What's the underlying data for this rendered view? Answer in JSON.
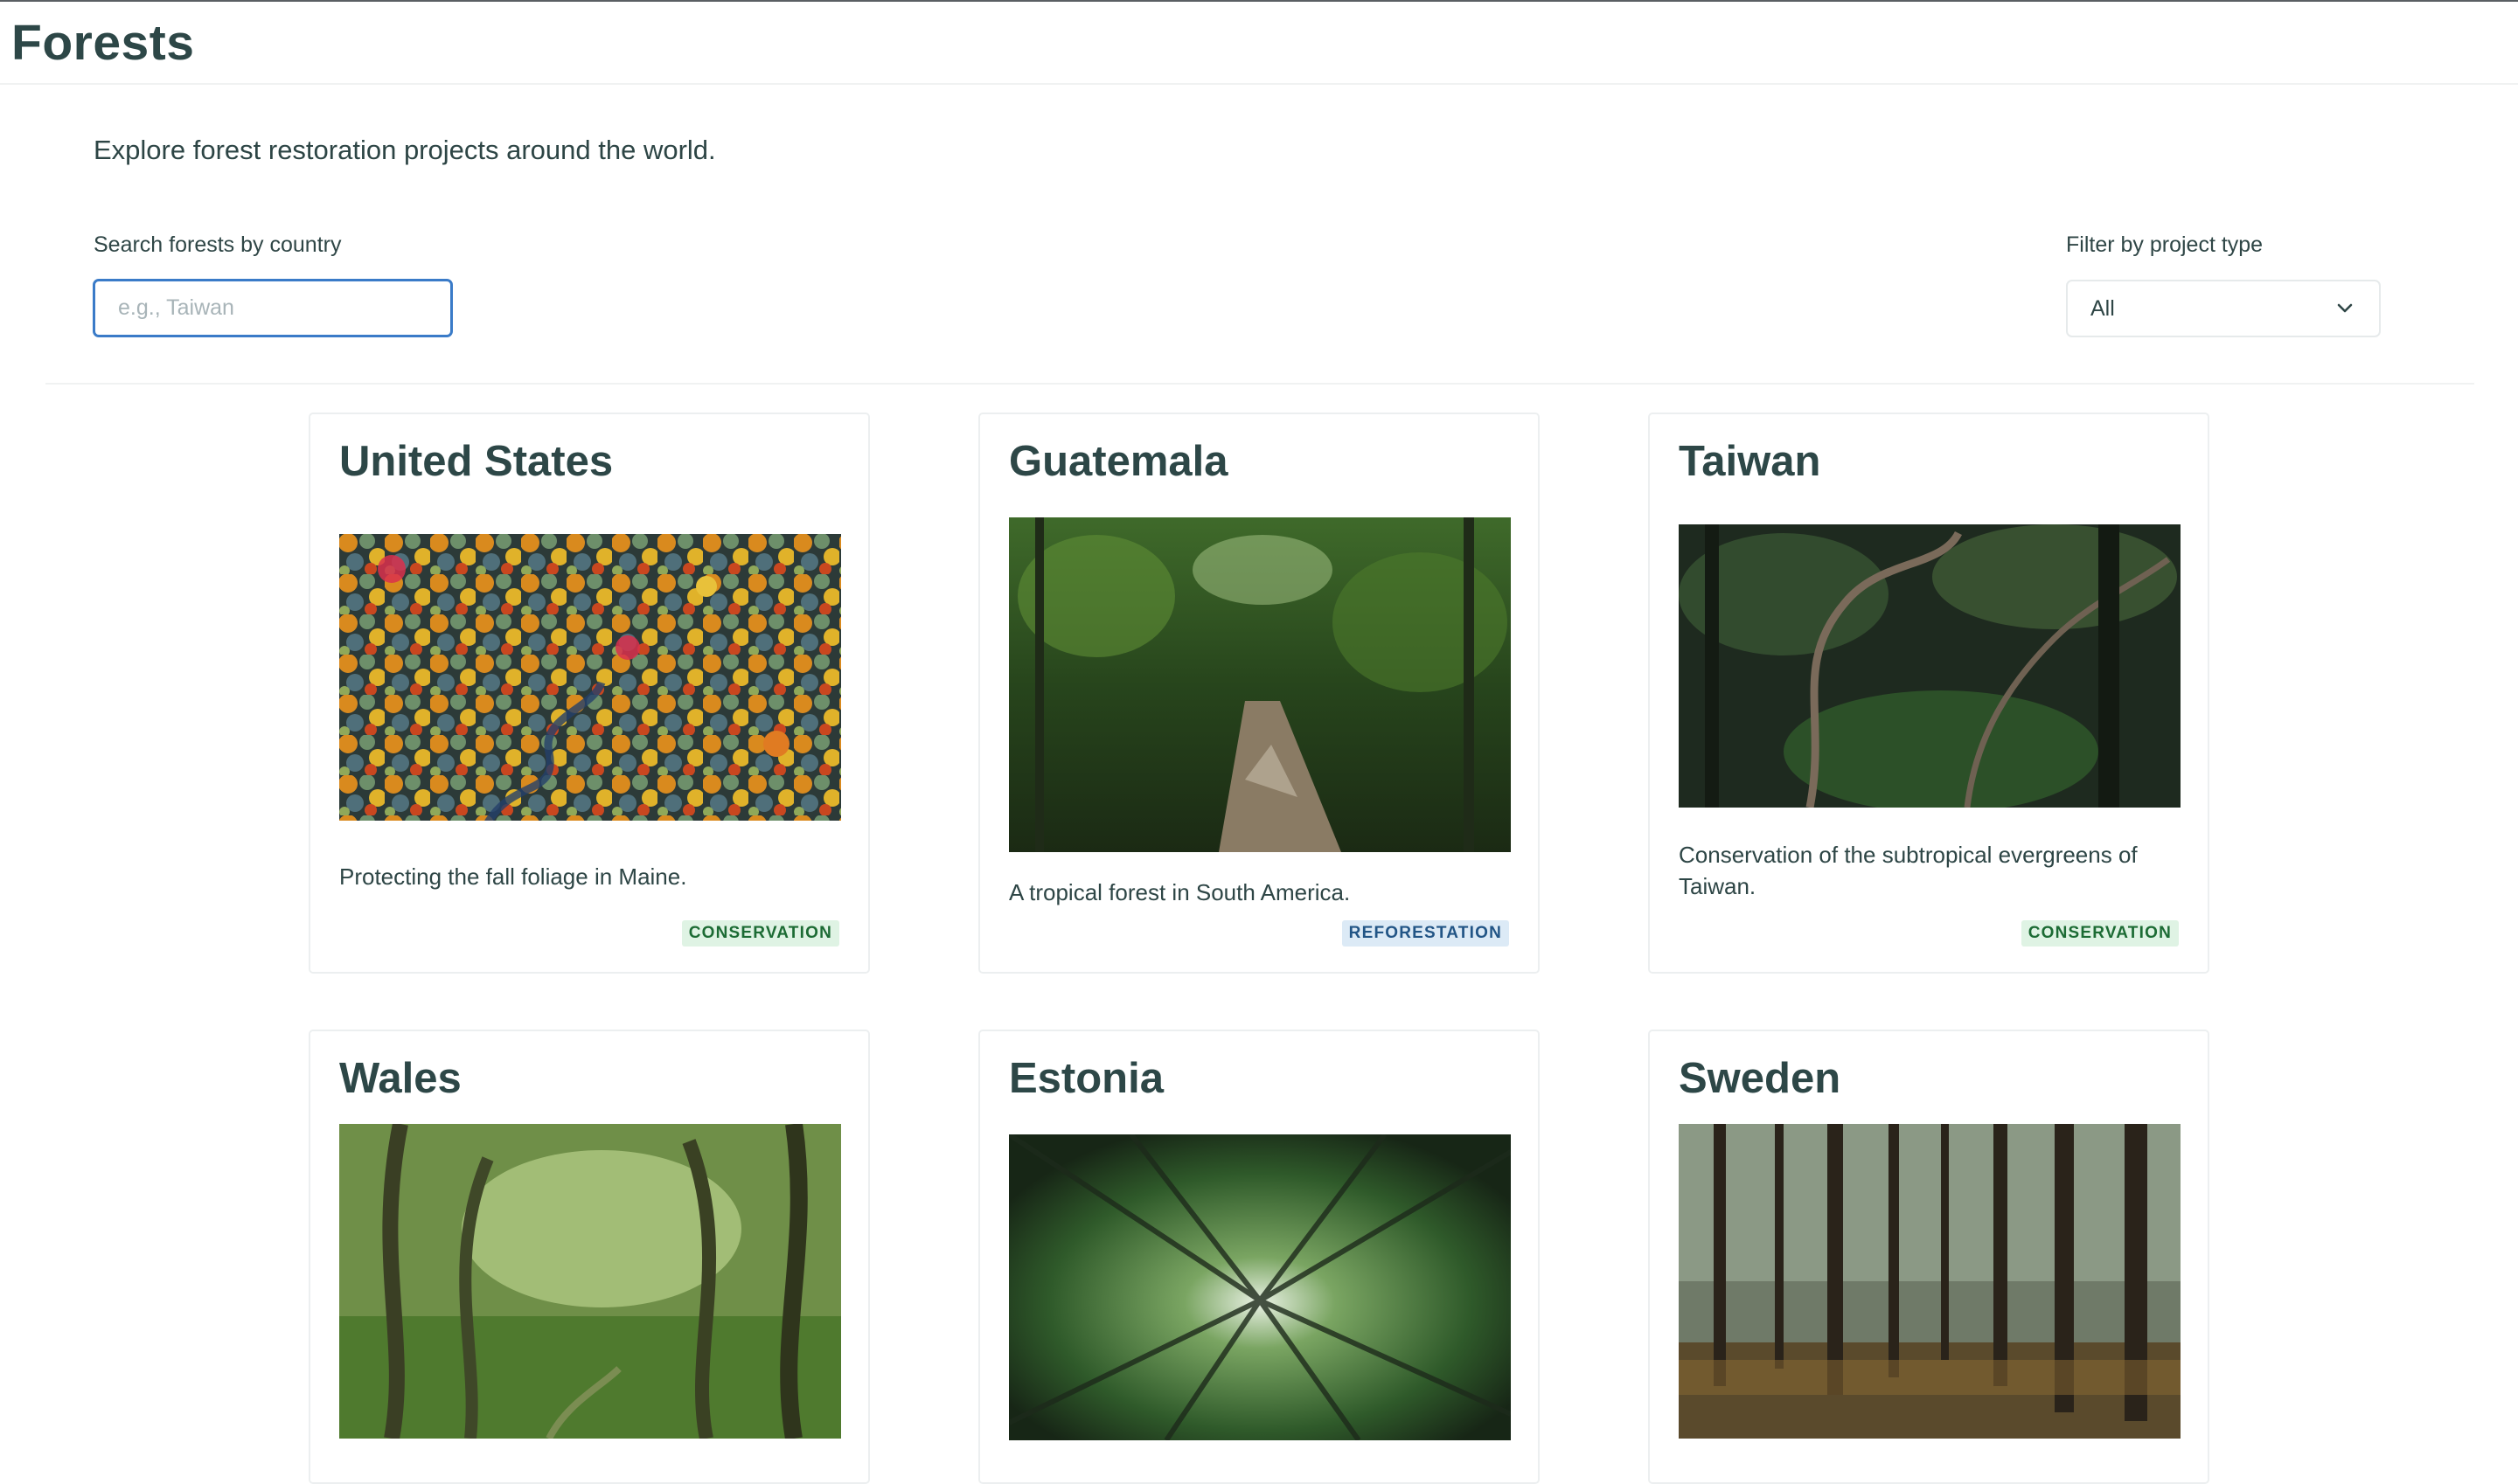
{
  "header": {
    "title": "Forests"
  },
  "intro": "Explore forest restoration projects around the world.",
  "search": {
    "label": "Search forests by country",
    "placeholder": "e.g., Taiwan",
    "value": ""
  },
  "filter": {
    "label": "Filter by project type",
    "selected": "All"
  },
  "cards": [
    {
      "country": "United States",
      "description": "Protecting the fall foliage in Maine.",
      "badge": "CONSERVATION",
      "image": "aerial-autumn-forest"
    },
    {
      "country": "Guatemala",
      "description": "A tropical forest in South America.",
      "badge": "REFORESTATION",
      "image": "jungle-path"
    },
    {
      "country": "Taiwan",
      "description": "Conservation of the subtropical evergreens of Taiwan.",
      "badge": "CONSERVATION",
      "image": "subtropical-evergreens"
    },
    {
      "country": "Wales",
      "description": "",
      "badge": "",
      "image": "mossy-woodland"
    },
    {
      "country": "Estonia",
      "description": "",
      "badge": "",
      "image": "canopy-looking-up"
    },
    {
      "country": "Sweden",
      "description": "",
      "badge": "",
      "image": "pine-forest-trunks"
    }
  ],
  "colors": {
    "accent": "#3a7bc8",
    "title": "#2d4747",
    "conservation_bg": "#dff3e4",
    "conservation_text": "#1c6b34",
    "reforestation_bg": "#dceaf6",
    "reforestation_text": "#225586"
  }
}
